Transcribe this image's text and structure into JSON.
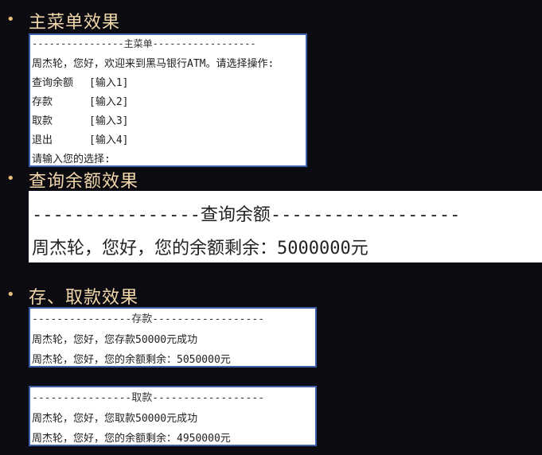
{
  "sections": {
    "menu": {
      "heading": "主菜单效果",
      "header": "----------------主菜单------------------",
      "greeting": "周杰轮，您好，欢迎来到黑马银行ATM。请选择操作:",
      "options": [
        {
          "label": "查询余额",
          "key": "[输入1]"
        },
        {
          "label": "存款",
          "key": "[输入2]"
        },
        {
          "label": "取款",
          "key": "[输入3]"
        },
        {
          "label": "退出",
          "key": "[输入4]"
        }
      ],
      "prompt": "请输入您的选择:"
    },
    "balance": {
      "heading": "查询余额效果",
      "header": "----------------查询余额------------------",
      "message": "周杰轮，您好，您的余额剩余：5000000元"
    },
    "transactions": {
      "heading": "存、取款效果",
      "deposit": {
        "header": "----------------存款------------------",
        "line1": "周杰轮，您好，您存款50000元成功",
        "line2": "周杰轮，您好，您的余额剩余：5050000元"
      },
      "withdraw": {
        "header": "----------------取款------------------",
        "line1": "周杰轮，您好，您取款50000元成功",
        "line2": "周杰轮，您好，您的余额剩余：4950000元"
      }
    }
  },
  "colors": {
    "background": "#0c0b12",
    "heading": "#f1d7a9",
    "bullet": "#e8c07a",
    "panel_border": "#3f5fa8"
  }
}
